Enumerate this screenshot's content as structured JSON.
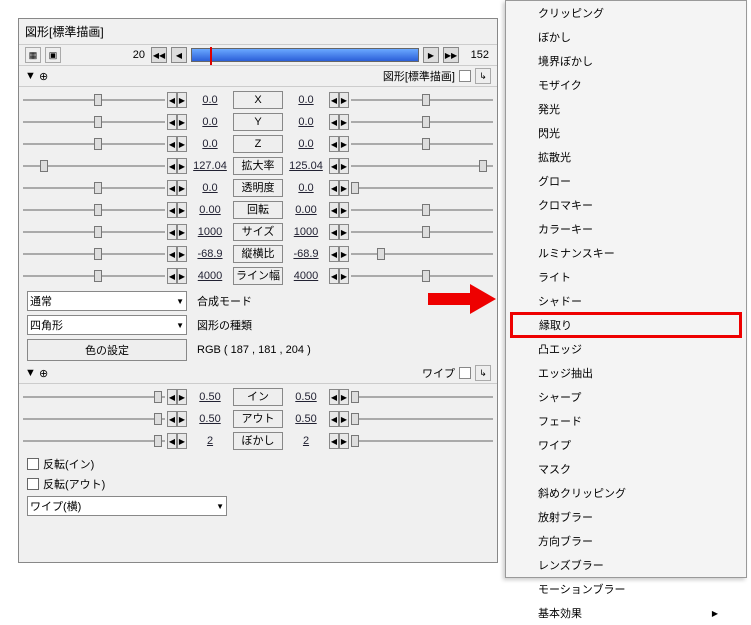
{
  "window_title": "図形[標準描画]",
  "timeline": {
    "start": "20",
    "end": "152"
  },
  "section1": {
    "title": "図形[標準描画]"
  },
  "params": [
    {
      "v1": "0.0",
      "lbl": "X",
      "v2": "0.0",
      "p1": 50,
      "p2": 50
    },
    {
      "v1": "0.0",
      "lbl": "Y",
      "v2": "0.0",
      "p1": 50,
      "p2": 50
    },
    {
      "v1": "0.0",
      "lbl": "Z",
      "v2": "0.0",
      "p1": 50,
      "p2": 50
    },
    {
      "v1": "127.04",
      "lbl": "拡大率",
      "v2": "125.04",
      "p1": 12,
      "p2": 90
    },
    {
      "v1": "0.0",
      "lbl": "透明度",
      "v2": "0.0",
      "p1": 50,
      "p2": 0
    },
    {
      "v1": "0.00",
      "lbl": "回転",
      "v2": "0.00",
      "p1": 50,
      "p2": 50
    },
    {
      "v1": "1000",
      "lbl": "サイズ",
      "v2": "1000",
      "p1": 50,
      "p2": 50
    },
    {
      "v1": "-68.9",
      "lbl": "縦横比",
      "v2": "-68.9",
      "p1": 50,
      "p2": 18
    },
    {
      "v1": "4000",
      "lbl": "ライン幅",
      "v2": "4000",
      "p1": 50,
      "p2": 50
    }
  ],
  "blend_label": "合成モード",
  "blend_value": "通常",
  "shape_label": "図形の種類",
  "shape_value": "四角形",
  "color_btn": "色の設定",
  "color_text": "RGB ( 187 , 181 , 204 )",
  "section2": {
    "title": "ワイプ"
  },
  "wipe_params": [
    {
      "v1": "0.50",
      "lbl": "イン",
      "v2": "0.50",
      "p1": 92,
      "p2": 0
    },
    {
      "v1": "0.50",
      "lbl": "アウト",
      "v2": "0.50",
      "p1": 92,
      "p2": 0
    },
    {
      "v1": "2",
      "lbl": "ぼかし",
      "v2": "2",
      "p1": 92,
      "p2": 0
    }
  ],
  "chk_in": "反転(イン)",
  "chk_out": "反転(アウト)",
  "wipe_type": "ワイプ(横)",
  "menu": [
    "クリッピング",
    "ぼかし",
    "境界ぼかし",
    "モザイク",
    "発光",
    "閃光",
    "拡散光",
    "グロー",
    "クロマキー",
    "カラーキー",
    "ルミナンスキー",
    "ライト",
    "シャドー",
    "縁取り",
    "凸エッジ",
    "エッジ抽出",
    "シャープ",
    "フェード",
    "ワイプ",
    "マスク",
    "斜めクリッピング",
    "放射ブラー",
    "方向ブラー",
    "レンズブラー",
    "モーションブラー",
    "基本効果"
  ],
  "highlight_index": 13,
  "submenu_index": 25
}
